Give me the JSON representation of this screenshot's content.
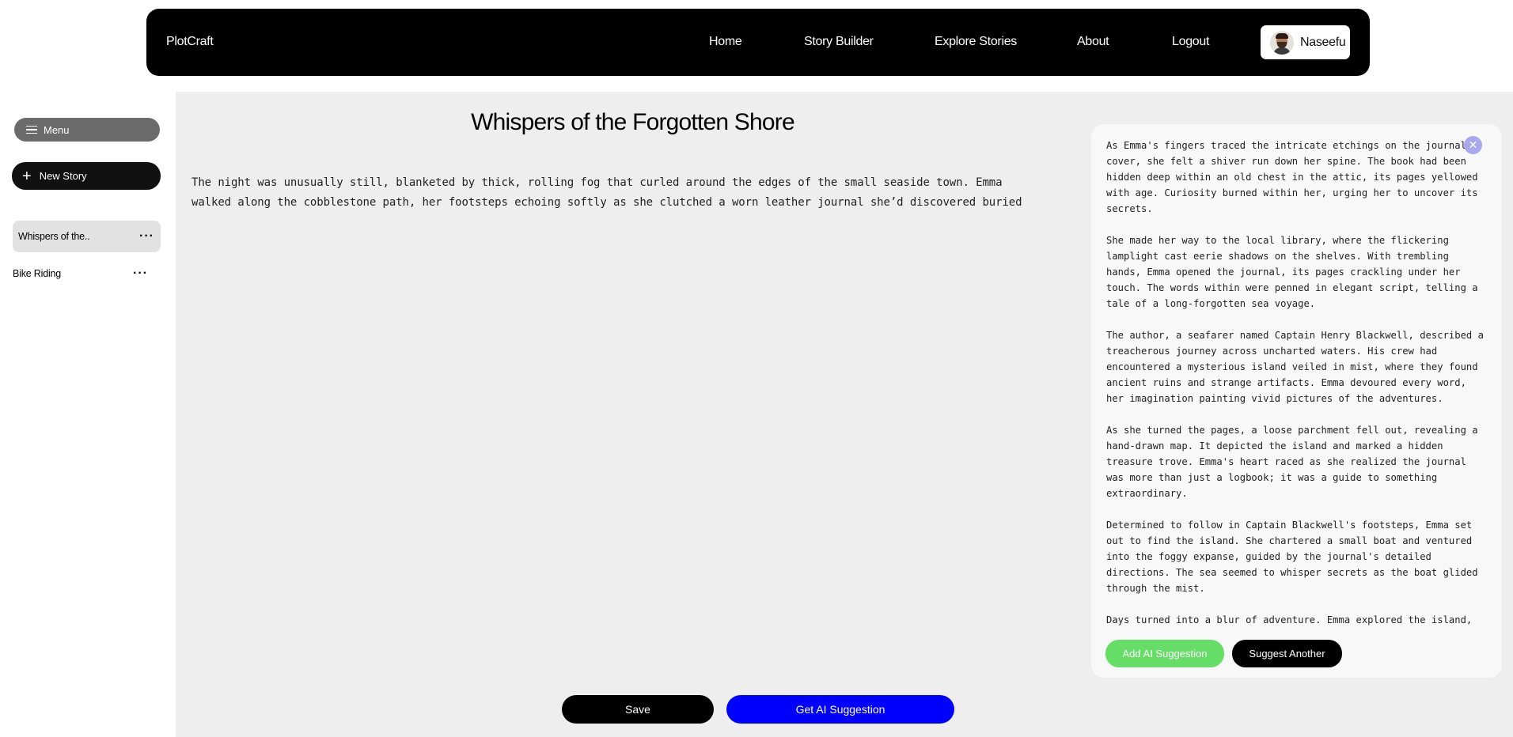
{
  "nav": {
    "brand": "PlotCraft",
    "links": [
      "Home",
      "Story Builder",
      "Explore Stories",
      "About",
      "Logout"
    ],
    "user_name": "Naseefu"
  },
  "sidebar": {
    "menu_label": "Menu",
    "new_story_label": "New Story",
    "stories": [
      {
        "title": "Whispers of the..",
        "active": true
      },
      {
        "title": "Bike Riding",
        "active": false
      }
    ]
  },
  "editor": {
    "title": "Whispers of the Forgotten Shore",
    "body": "The night was unusually still, blanketed by thick, rolling fog that curled around the edges of the small seaside town. Emma walked along the cobblestone path, her footsteps echoing softly as she clutched a worn leather journal she’d discovered buried",
    "save_label": "Save",
    "ai_label": "Get AI Suggestion"
  },
  "suggestion": {
    "close_symbol": "✕",
    "paragraphs": [
      "As Emma's fingers traced the intricate etchings on the journal's cover, she felt a shiver run down her spine. The book had been hidden deep within an old chest in the attic, its pages yellowed with age. Curiosity burned within her, urging her to uncover its secrets.",
      "She made her way to the local library, where the flickering lamplight cast eerie shadows on the shelves. With trembling hands, Emma opened the journal, its pages crackling under her touch. The words within were penned in elegant script, telling a tale of a long-forgotten sea voyage.",
      "The author, a seafarer named Captain Henry Blackwell, described a treacherous journey across uncharted waters. His crew had encountered a mysterious island veiled in mist, where they found ancient ruins and strange artifacts. Emma devoured every word, her imagination painting vivid pictures of the adventures.",
      "As she turned the pages, a loose parchment fell out, revealing a hand-drawn map. It depicted the island and marked a hidden treasure trove. Emma's heart raced as she realized the journal was more than just a logbook; it was a guide to something extraordinary.",
      "Determined to follow in Captain Blackwell's footsteps, Emma set out to find the island. She chartered a small boat and ventured into the foggy expanse, guided by the journal's detailed directions. The sea seemed to whisper secrets as the boat glided through the mist.",
      "Days turned into a blur of adventure. Emma explored the island,"
    ],
    "add_label": "Add AI Suggestion",
    "another_label": "Suggest Another"
  }
}
